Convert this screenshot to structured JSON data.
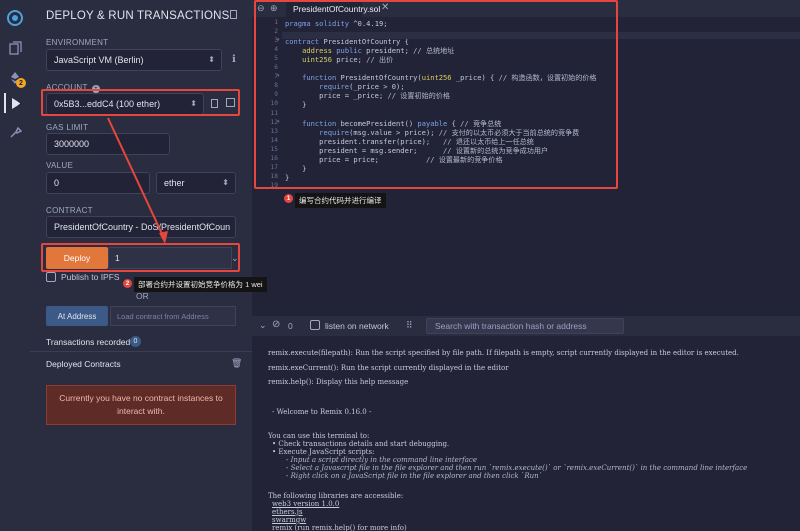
{
  "colors": {
    "accent": "#e2773b",
    "annotation": "#e5463d",
    "info": "#3c5a87",
    "warning_bg": "#5f2b27"
  },
  "iconbar": {
    "plugin_badge": "2"
  },
  "panel": {
    "title": "DEPLOY & RUN TRANSACTIONS",
    "environment_label": "ENVIRONMENT",
    "environment_value": "JavaScript VM (Berlin)",
    "account_label": "ACCOUNT",
    "account_value": "0x5B3...eddC4 (100 ether)",
    "gas_limit_label": "GAS LIMIT",
    "gas_limit_value": "3000000",
    "value_label": "VALUE",
    "value_amount": "0",
    "value_unit": "ether",
    "contract_label": "CONTRACT",
    "contract_value": "PresidentOfCountry - DoS/PresidentOfCoun",
    "deploy_label": "Deploy",
    "deploy_arg": "1",
    "publish_ipfs": "Publish to IPFS",
    "or_text": "OR",
    "at_address": "At Address",
    "load_contract_placeholder": "Load contract from Address",
    "transactions_recorded": "Transactions recorded",
    "transactions_count": "0",
    "deployed_contracts": "Deployed Contracts",
    "no_instances": "Currently you have no contract instances to interact with."
  },
  "annotations": {
    "note1_num": "1",
    "note1_text": "编写合约代码并进行编译",
    "note2_num": "2",
    "note2_text": "部署合约并设置初始竞争价格为 1 wei"
  },
  "editor": {
    "tab_name": "PresidentOfCountry.sol",
    "line_numbers": [
      "1",
      "2",
      "3",
      "4",
      "5",
      "6",
      "7",
      "8",
      "9",
      "10",
      "11",
      "12",
      "13",
      "14",
      "15",
      "16",
      "17",
      "18",
      "19"
    ],
    "code": [
      "pragma solidity ^0.4.19;",
      "",
      "contract PresidentOfCountry {",
      "    address public president; // 总统地址",
      "    uint256 price; // 出价",
      "",
      "    function PresidentOfCountry(uint256 _price) { // 构造函数，设置初始的价格",
      "        require(_price > 0);",
      "        price = _price; // 设置初始的价格",
      "    }",
      "",
      "    function becomePresident() payable { // 竞争总统",
      "        require(msg.value > price); // 支付的以太币必须大于当前总统的竞争费",
      "        president.transfer(price);   // 退还以太币给上一任总统",
      "        president = msg.sender;      // 设置新的总统为竞争成功用户",
      "        price = price;           // 设置最新的竞争价格",
      "    }",
      "}",
      ""
    ]
  },
  "terminal": {
    "count": "0",
    "listen_label": "listen on network",
    "search_placeholder": "Search with transaction hash or address",
    "lines": [
      "remix.execute(filepath): Run the script specified by file path. If filepath is empty, script currently displayed in the editor is executed.",
      "remix.exeCurrent(): Run the script currently displayed in the editor",
      "remix.help(): Display this help message",
      "- Welcome to Remix 0.16.0 -",
      "You can use this terminal to:",
      "• Check transactions details and start debugging.",
      "• Execute JavaScript scripts:",
      "- Input a script directly in the command line interface",
      "- Select a Javascript file in the file explorer and then run `remix.execute()` or `remix.exeCurrent()` in the command line interface",
      "- Right click on a JavaScript file in the file explorer and then click `Run`",
      "The following libraries are accessible:",
      "web3 version 1.0.0",
      "ethers.js",
      "swarmgw",
      "remix (run remix.help() for more info)"
    ]
  }
}
